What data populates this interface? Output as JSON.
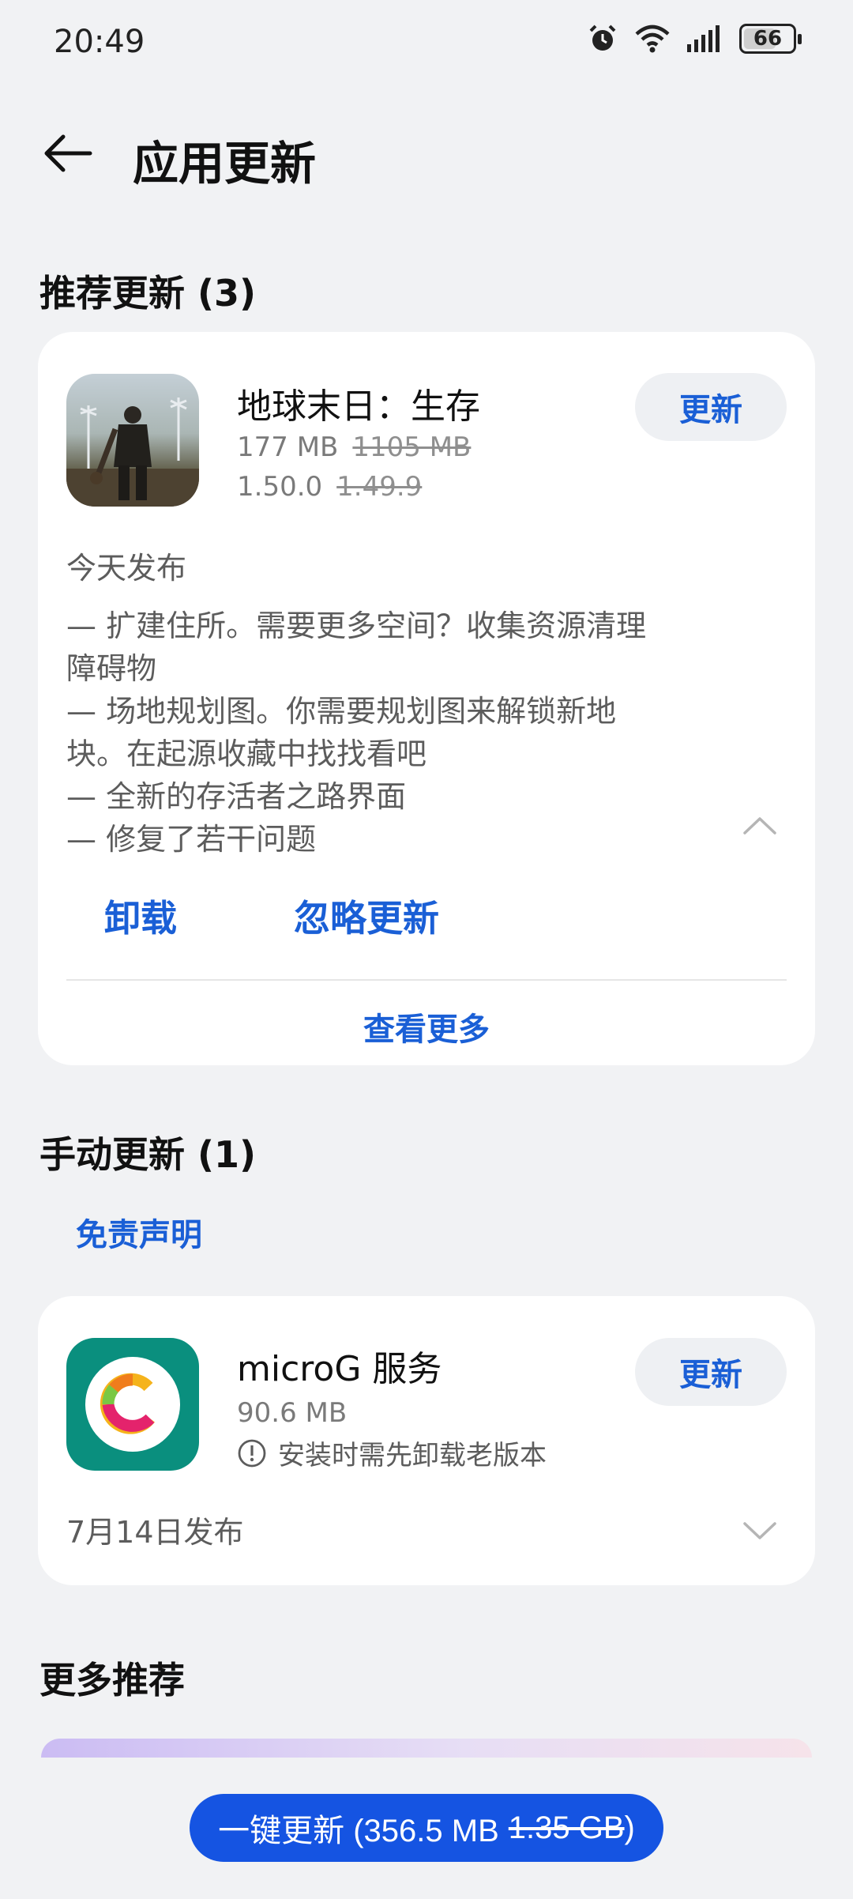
{
  "status_bar": {
    "time": "20:49",
    "battery": "66",
    "battery_level": 0.66
  },
  "header": {
    "title": "应用更新"
  },
  "recommended": {
    "title": "推荐更新 (3)",
    "app": {
      "name": "地球末日：生存",
      "size": "177 MB",
      "old_size": "1105 MB",
      "version": "1.50.0",
      "old_version": "1.49.9",
      "update_label": "更新",
      "release": "今天发布",
      "notes": [
        "— 扩建住所。需要更多空间？收集资源清理",
        "障碍物",
        "— 场地规划图。你需要规划图来解锁新地",
        "块。在起源收藏中找找看吧",
        "— 全新的存活者之路界面",
        "— 修复了若干问题"
      ],
      "uninstall_label": "卸载",
      "ignore_label": "忽略更新"
    },
    "view_more": "查看更多"
  },
  "manual": {
    "title": "手动更新 (1)",
    "disclaimer": "免责声明",
    "app": {
      "name": "microG 服务",
      "size": "90.6 MB",
      "warning": "安装时需先卸载老版本",
      "update_label": "更新",
      "release": "7月14日发布"
    }
  },
  "more": {
    "title": "更多推荐"
  },
  "bottom": {
    "update_all_label": "一键更新 (356.5 MB",
    "old_total": "1.35 GB",
    "close_paren": ")"
  },
  "colors": {
    "accent": "#1a5fd6",
    "primary_button": "#1554e2",
    "microg_tile": "#0a8f7e"
  }
}
